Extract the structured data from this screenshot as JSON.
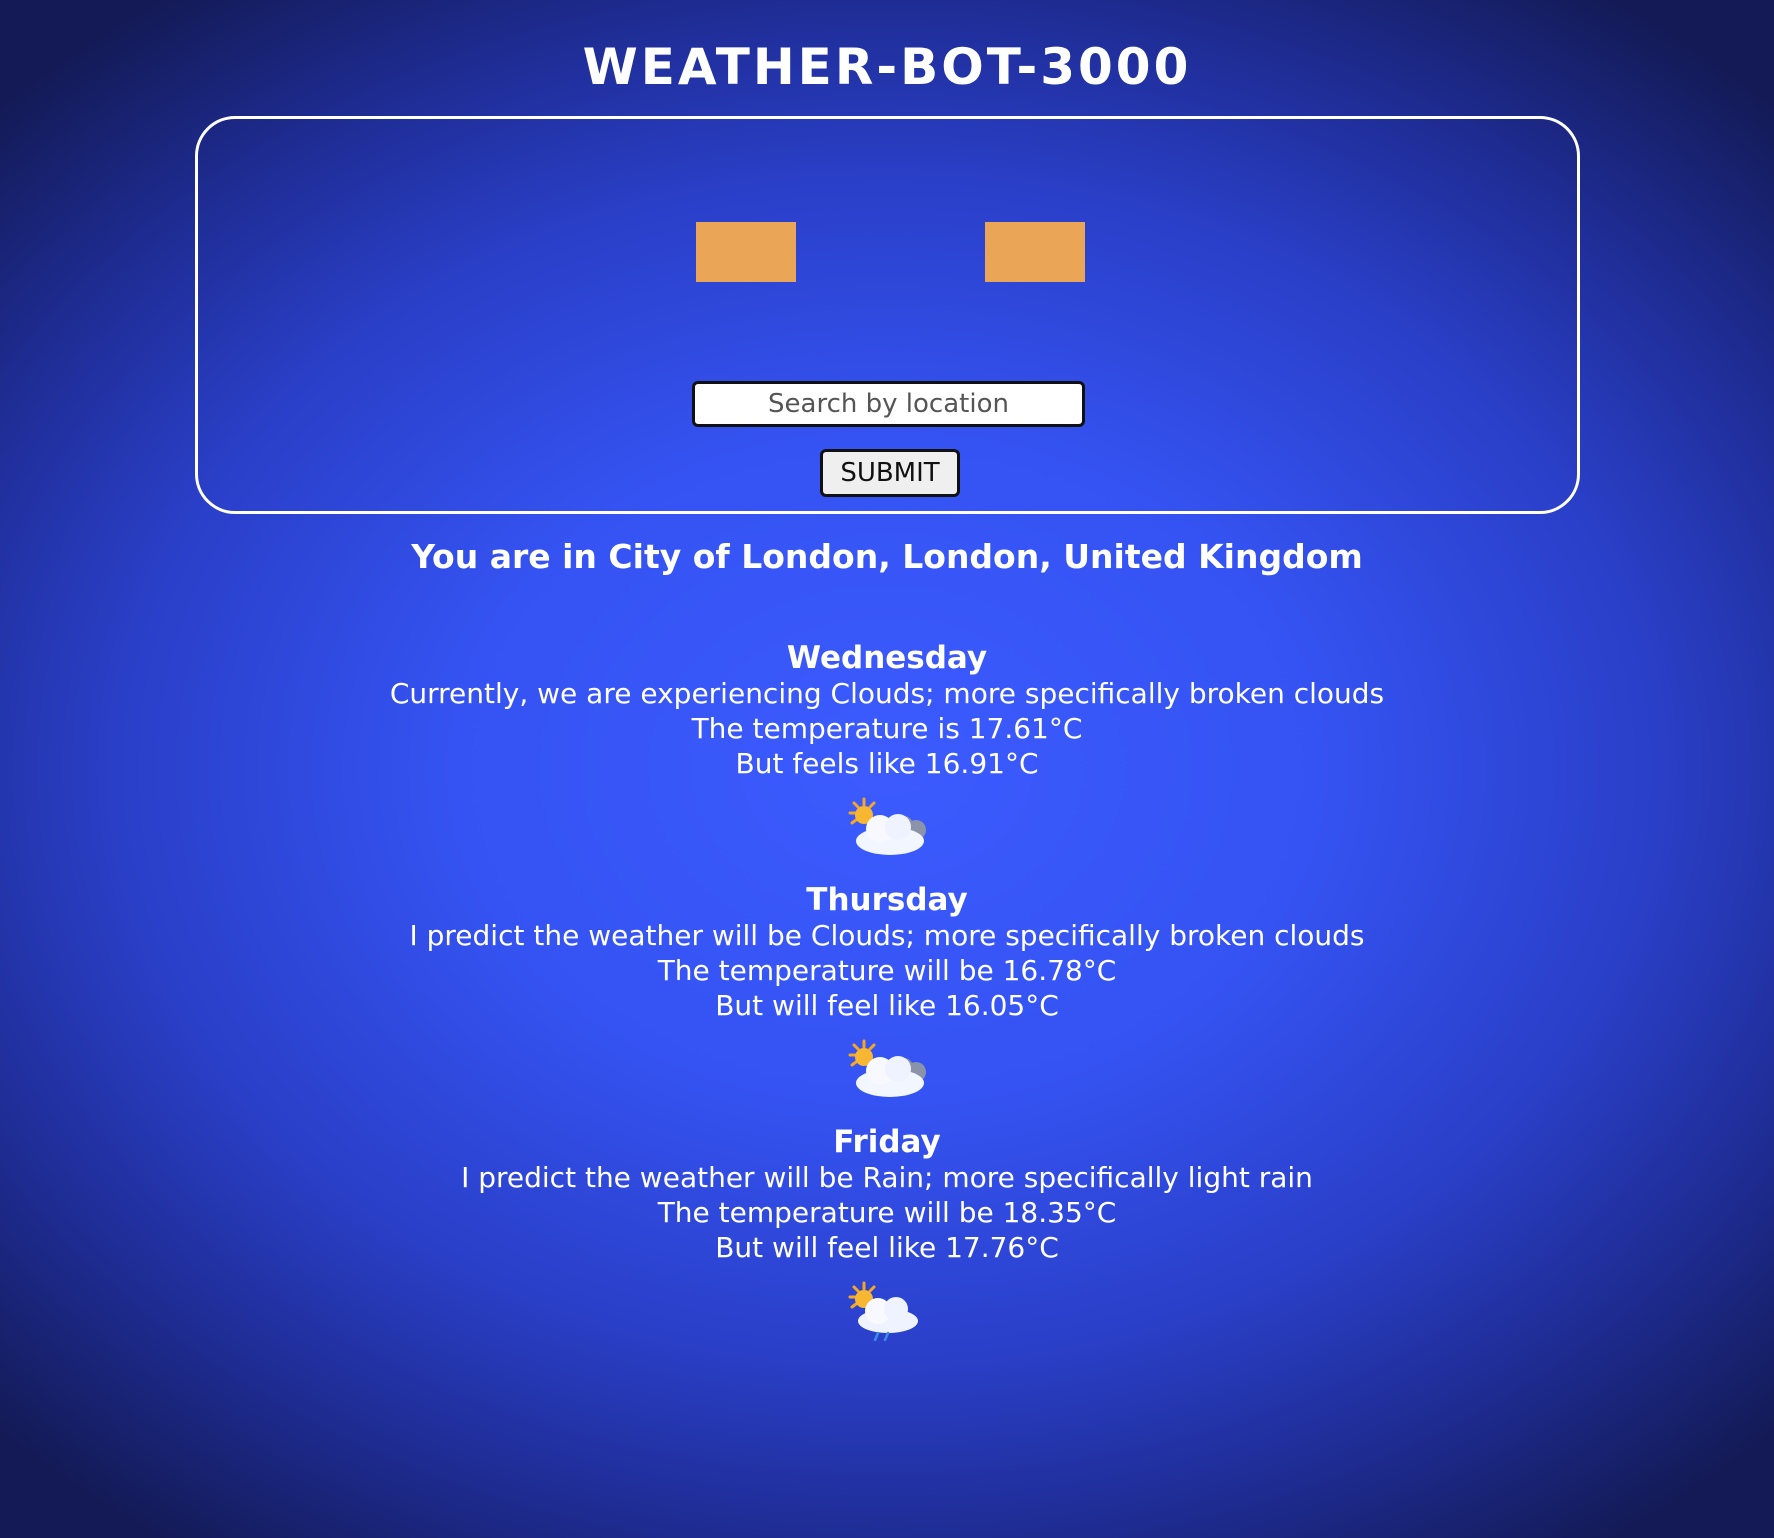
{
  "app": {
    "title": "WEATHER-BOT-3000"
  },
  "search": {
    "placeholder": "Search by location",
    "value": "",
    "submit_label": "SUBMIT"
  },
  "location_text": "You are in City of London, London, United Kingdom",
  "colors": {
    "eyes": "#eba557",
    "background_center": "#3c5bff",
    "background_edge": "#131a55"
  },
  "forecast": [
    {
      "day": "Wednesday",
      "line1": "Currently, we are experiencing Clouds; more specifically broken clouds",
      "line2": "The temperature is 17.61°C",
      "line3": "But feels like 16.91°C",
      "icon": "sun-behind-cloud-icon"
    },
    {
      "day": "Thursday",
      "line1": "I predict the weather will be Clouds; more specifically broken clouds",
      "line2": "The temperature will be 16.78°C",
      "line3": "But will feel like 16.05°C",
      "icon": "sun-behind-cloud-icon"
    },
    {
      "day": "Friday",
      "line1": "I predict the weather will be Rain; more specifically light rain",
      "line2": "The temperature will be 18.35°C",
      "line3": "But will feel like 17.76°C",
      "icon": "sun-behind-rain-cloud-icon"
    }
  ]
}
